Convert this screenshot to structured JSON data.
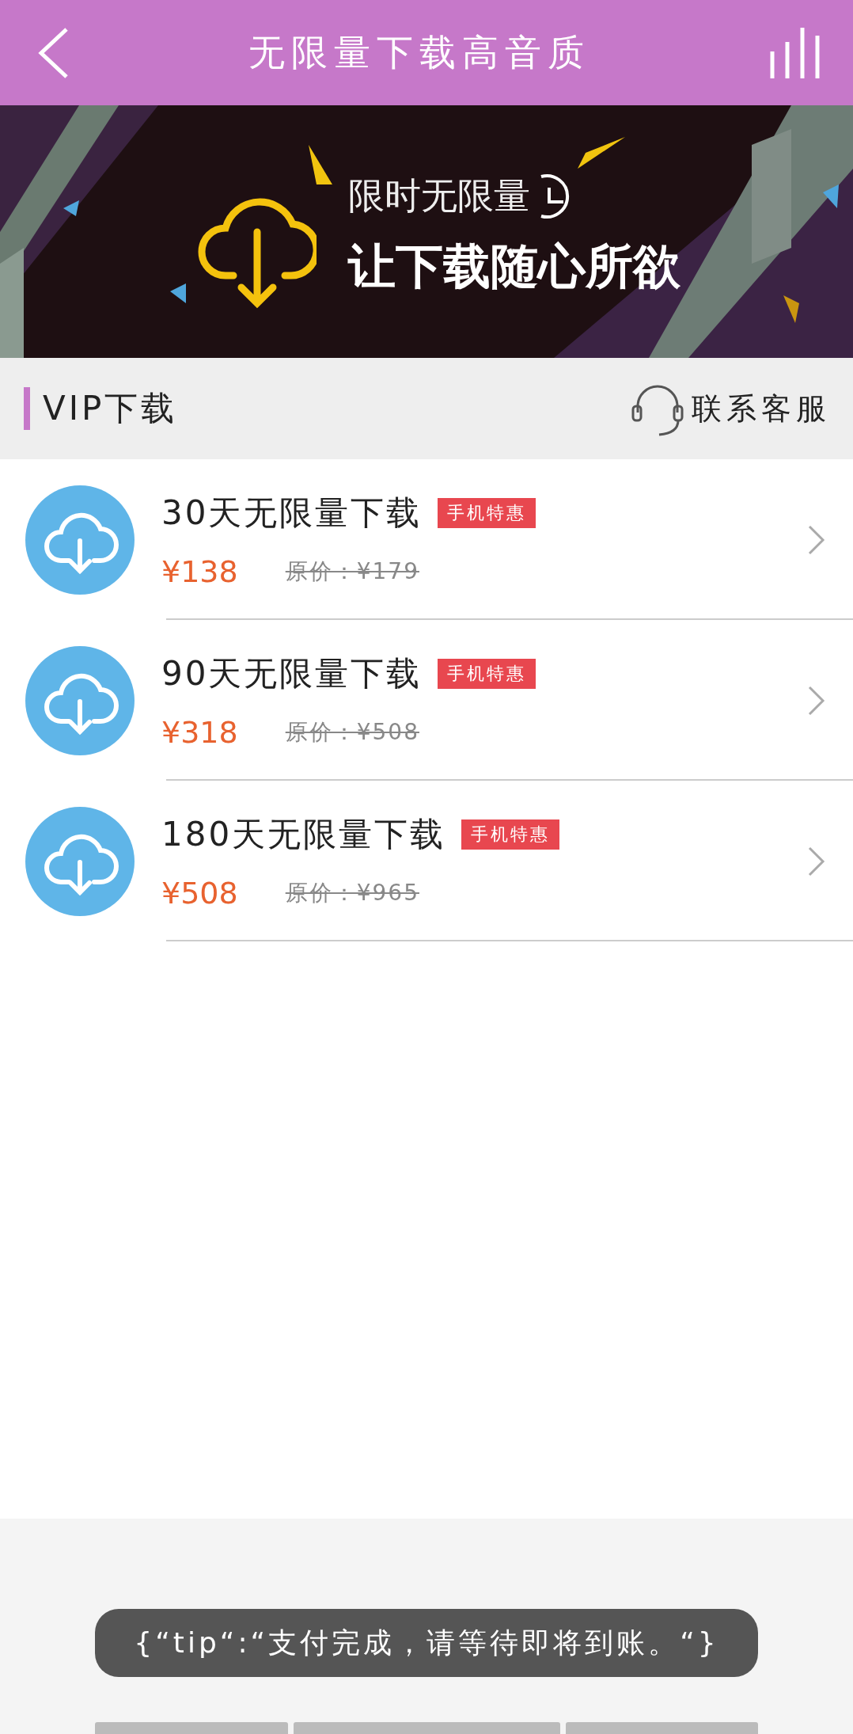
{
  "header": {
    "title": "无限量下载高音质"
  },
  "banner": {
    "headline": "限时无限量",
    "subline": "让下载随心所欲"
  },
  "section": {
    "title": "VIP下载",
    "service": "联系客服"
  },
  "plans": [
    {
      "name": "30天无限量下载",
      "tag": "手机特惠",
      "price": "¥138",
      "original": "原价：¥179"
    },
    {
      "name": "90天无限量下载",
      "tag": "手机特惠",
      "price": "¥318",
      "original": "原价：¥508"
    },
    {
      "name": "180天无限量下载",
      "tag": "手机特惠",
      "price": "¥508",
      "original": "原价：¥965"
    }
  ],
  "toast": {
    "text": "{“tip“:“支付完成，请等待即将到账。“}"
  }
}
